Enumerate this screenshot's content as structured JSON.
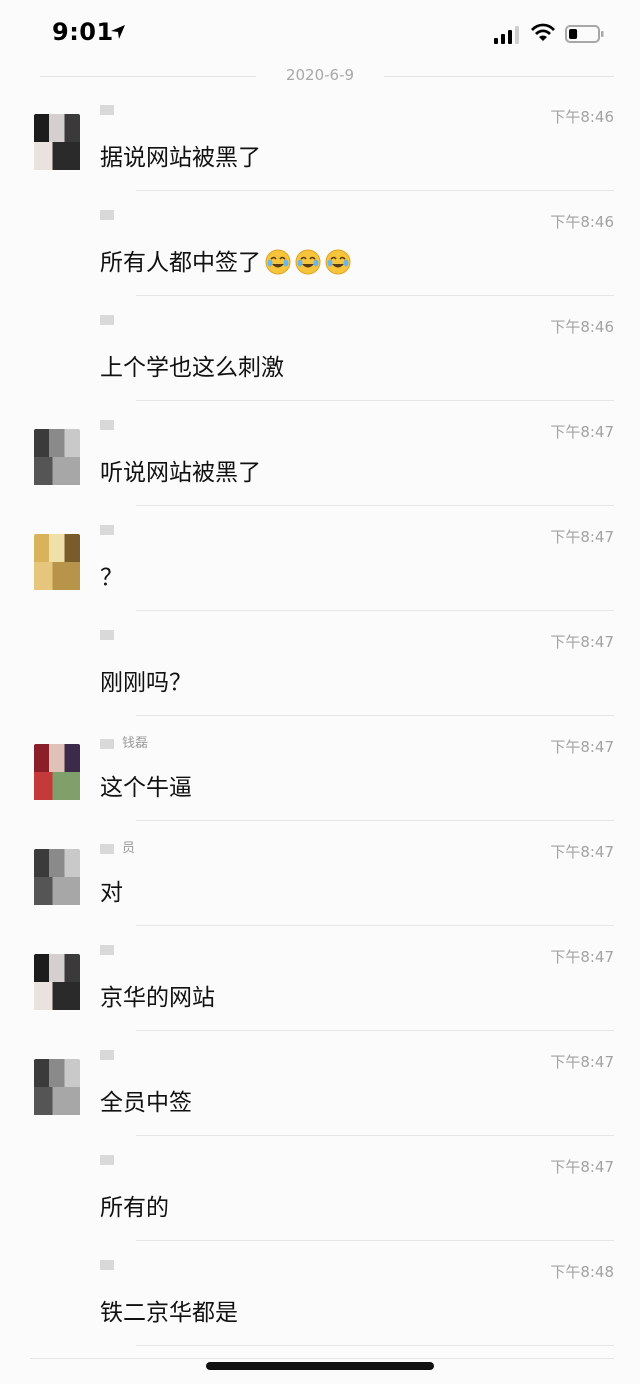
{
  "status_bar": {
    "time": "9:01",
    "location_icon": "location-arrow-icon",
    "signal_icon": "cellular-signal-icon",
    "wifi_icon": "wifi-icon",
    "battery_icon": "battery-icon",
    "battery_level": 0.3
  },
  "date_divider": "2020-6-9",
  "messages": [
    {
      "sender": "",
      "text": "据说网站被黑了",
      "time": "下午8:46",
      "avatar": "avatar-a"
    },
    {
      "sender": "",
      "text": "所有人都中签了",
      "time": "下午8:46",
      "avatar": "",
      "emoji_count": 3,
      "emoji": "face-with-tears-of-joy-icon"
    },
    {
      "sender": "",
      "text": "上个学也这么刺激",
      "time": "下午8:46",
      "avatar": ""
    },
    {
      "sender": "",
      "text": "听说网站被黑了",
      "time": "下午8:47",
      "avatar": "avatar-b"
    },
    {
      "sender": "",
      "text": "？",
      "time": "下午8:47",
      "avatar": "avatar-c"
    },
    {
      "sender": "",
      "text": "刚刚吗？",
      "time": "下午8:47",
      "avatar": ""
    },
    {
      "sender": "钱磊",
      "text": "这个牛逼",
      "time": "下午8:47",
      "avatar": "avatar-d"
    },
    {
      "sender": "员",
      "text": "对",
      "time": "下午8:47",
      "avatar": "avatar-b"
    },
    {
      "sender": "",
      "text": "京华的网站",
      "time": "下午8:47",
      "avatar": "avatar-a"
    },
    {
      "sender": "",
      "text": "全员中签",
      "time": "下午8:47",
      "avatar": "avatar-b"
    },
    {
      "sender": "",
      "text": "所有的",
      "time": "下午8:47",
      "avatar": ""
    },
    {
      "sender": "",
      "text": "铁二京华都是",
      "time": "下午8:48",
      "avatar": ""
    }
  ],
  "colors": {
    "background": "#fbfbfb",
    "text": "#111111",
    "time": "#a3a3a3",
    "divider": "#e6e6e6"
  }
}
